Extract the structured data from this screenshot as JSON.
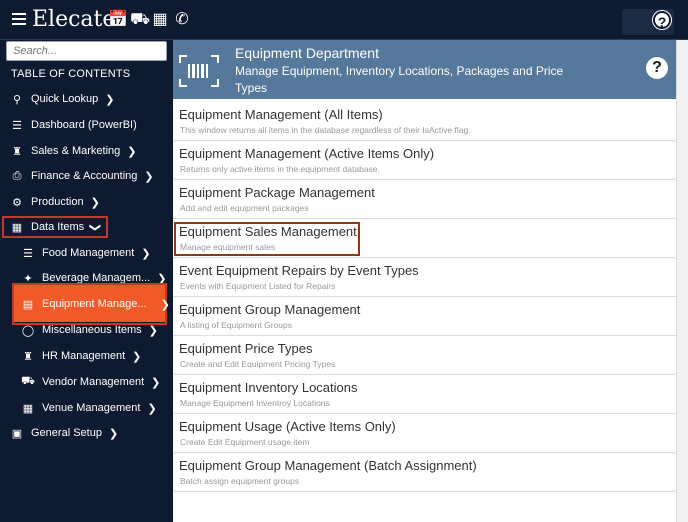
{
  "app": {
    "brand": "Elecate"
  },
  "topbar": {
    "icons": [
      "calendar-icon",
      "truck-icon",
      "building-icon",
      "phone-icon"
    ],
    "help_label": "?"
  },
  "sidebar": {
    "search_placeholder": "Search...",
    "toc_label": "TABLE OF CONTENTS",
    "items": [
      {
        "label": "Quick Lookup",
        "icon": "search-icon"
      },
      {
        "label": "Dashboard (PowerBI)",
        "icon": "list-icon"
      },
      {
        "label": "Sales & Marketing",
        "icon": "people-icon"
      },
      {
        "label": "Finance & Accounting",
        "icon": "printer-icon"
      },
      {
        "label": "Production",
        "icon": "production-icon"
      },
      {
        "label": "Data Items",
        "icon": "table-icon"
      },
      {
        "label": "Food Management",
        "icon": "list-icon"
      },
      {
        "label": "Beverage Managem...",
        "icon": "cocktail-icon"
      },
      {
        "label": "Equipment Manage...",
        "icon": "barcode-icon"
      },
      {
        "label": "Miscellaneous Items",
        "icon": "dollar-icon"
      },
      {
        "label": "HR Management",
        "icon": "people-icon"
      },
      {
        "label": "Vendor Management",
        "icon": "truck-icon"
      },
      {
        "label": "Venue Management",
        "icon": "building-icon"
      },
      {
        "label": "General Setup",
        "icon": "toolbox-icon"
      }
    ]
  },
  "department": {
    "title": "Equipment Department",
    "subtitle": "Manage Equipment, Inventory Locations, Packages and Price Types",
    "help_label": "?"
  },
  "list": [
    {
      "title": "Equipment Management (All Items)",
      "desc": "This window returns all items in the database regardless of their IsActive flag."
    },
    {
      "title": "Equipment Management (Active Items Only)",
      "desc": "Returns only active items in the equipment database."
    },
    {
      "title": "Equipment Package Management",
      "desc": "Add and edit equipment packages"
    },
    {
      "title": "Equipment Sales Management",
      "desc": "Manage equipment sales"
    },
    {
      "title": "Event Equipment Repairs by Event Types",
      "desc": "Events with Equipment Listed for Repairs"
    },
    {
      "title": "Equipment Group Management",
      "desc": "A listing of Equipment Groups"
    },
    {
      "title": "Equipment Price Types",
      "desc": "Create and Edit Equipment Pricing Types"
    },
    {
      "title": "Equipment Inventory Locations",
      "desc": "Manage Equipment Inventroy Locations"
    },
    {
      "title": "Equipment Usage (Active Items Only)",
      "desc": "Create Edit Equipment usage item"
    },
    {
      "title": "Equipment Group Management (Batch Assignment)",
      "desc": "Batch assign equipment groups"
    }
  ],
  "colors": {
    "nav_bg": "#0e1a30",
    "header_bg": "#56789a",
    "active": "#f05a28",
    "highlight": "#c0392b"
  }
}
